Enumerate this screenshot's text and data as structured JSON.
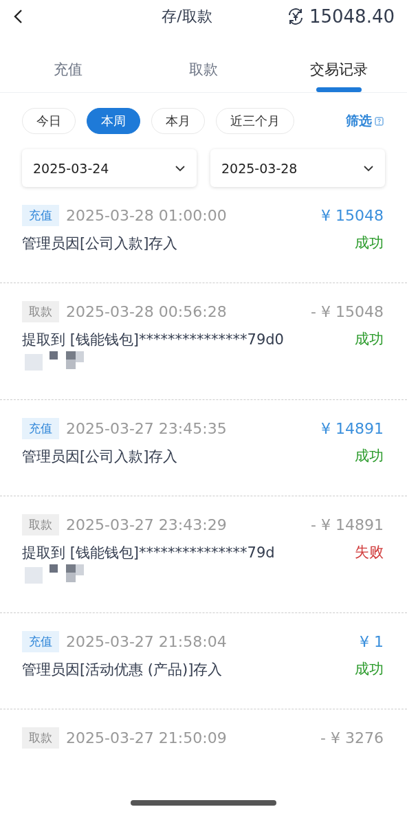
{
  "header": {
    "title": "存/取款",
    "balance": "15048.40"
  },
  "tabs": [
    {
      "label": "充值",
      "selected": false
    },
    {
      "label": "取款",
      "selected": false
    },
    {
      "label": "交易记录",
      "selected": true
    }
  ],
  "periods": [
    {
      "label": "今日",
      "selected": false
    },
    {
      "label": "本周",
      "selected": true
    },
    {
      "label": "本月",
      "selected": false
    },
    {
      "label": "近三个月",
      "selected": false
    }
  ],
  "filter": {
    "label": "筛选"
  },
  "date_range": {
    "start": "2025-03-24",
    "end": "2025-03-28"
  },
  "records": [
    {
      "kind": "deposit",
      "tag": "充值",
      "time": "2025-03-28 01:00:00",
      "amount": "¥ 15048",
      "description": "管理员因[公司入款]存入",
      "failed": false,
      "status": "成功",
      "redacted": false
    },
    {
      "kind": "withdraw",
      "tag": "取款",
      "time": "2025-03-28 00:56:28",
      "amount": "- ¥ 15048",
      "description": "提取到 [钱能钱包]***************79d0",
      "failed": false,
      "status": "成功",
      "redacted": true
    },
    {
      "kind": "deposit",
      "tag": "充值",
      "time": "2025-03-27 23:45:35",
      "amount": "¥ 14891",
      "description": "管理员因[公司入款]存入",
      "failed": false,
      "status": "成功",
      "redacted": false
    },
    {
      "kind": "withdraw",
      "tag": "取款",
      "time": "2025-03-27 23:43:29",
      "amount": "- ¥ 14891",
      "description": "提取到 [钱能钱包]***************79d",
      "failed": true,
      "status": "失败",
      "redacted": true
    },
    {
      "kind": "deposit",
      "tag": "充值",
      "time": "2025-03-27 21:58:04",
      "amount": "¥ 1",
      "description": "管理员因[活动优惠 (产品)]存入",
      "failed": false,
      "status": "成功",
      "redacted": false
    },
    {
      "kind": "withdraw",
      "tag": "取款",
      "time": "2025-03-27 21:50:09",
      "amount": "- ¥ 3276"
    }
  ]
}
